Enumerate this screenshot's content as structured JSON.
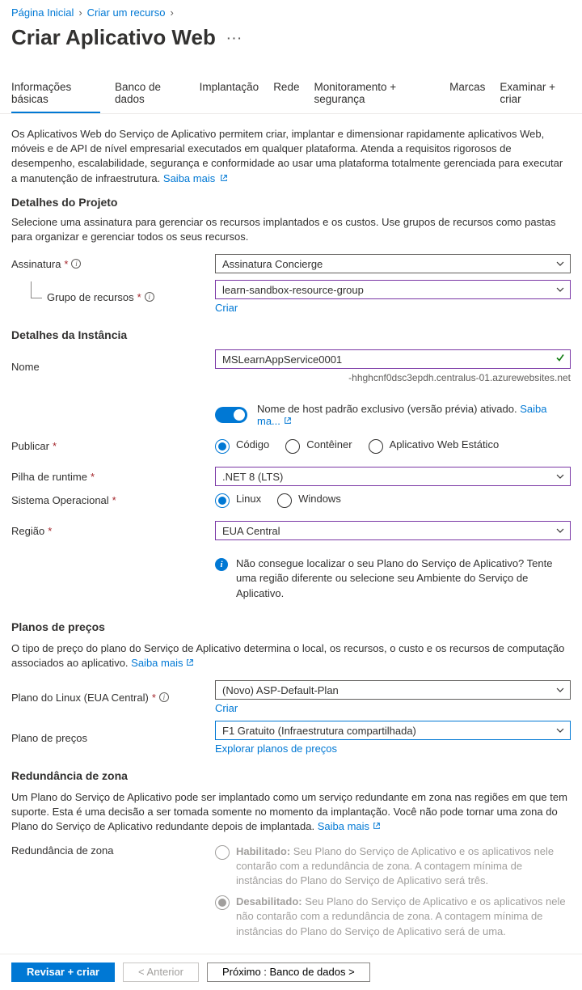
{
  "breadcrumb": {
    "home": "Página Inicial",
    "create": "Criar um recurso"
  },
  "title": "Criar Aplicativo Web",
  "tabs": [
    "Informações básicas",
    "Banco de dados",
    "Implantação",
    "Rede",
    "Monitoramento + segurança",
    "Marcas",
    "Examinar + criar"
  ],
  "intro": "Os Aplicativos Web do Serviço de Aplicativo permitem criar, implantar e dimensionar rapidamente aplicativos Web, móveis e de API de nível empresarial executados em qualquer plataforma. Atenda a requisitos rigorosos de desempenho, escalabilidade, segurança e conformidade ao usar uma plataforma totalmente gerenciada para executar a manutenção de infraestrutura.",
  "learn_more": "Saiba mais",
  "project": {
    "heading": "Detalhes do Projeto",
    "desc": "Selecione uma assinatura para gerenciar os recursos implantados e os custos. Use grupos de recursos como pastas para organizar e gerenciar todos os seus recursos.",
    "subscription_label": "Assinatura",
    "subscription_value": "Assinatura Concierge",
    "rg_label": "Grupo de recursos",
    "rg_value": "learn-sandbox-resource-group",
    "rg_create": "Criar"
  },
  "instance": {
    "heading": "Detalhes da Instância",
    "name_label": "Nome",
    "name_value": "MSLearnAppService0001",
    "hostname": "-hhghcnf0dsc3epdh.centralus-01.azurewebsites.net",
    "toggle_text": "Nome de host padrão exclusivo (versão prévia) ativado.",
    "toggle_link": "Saiba ma...",
    "publish_label": "Publicar",
    "publish_options": [
      "Código",
      "Contêiner",
      "Aplicativo Web Estático"
    ],
    "runtime_label": "Pilha de runtime",
    "runtime_value": ".NET 8 (LTS)",
    "os_label": "Sistema Operacional",
    "os_options": [
      "Linux",
      "Windows"
    ],
    "region_label": "Região",
    "region_value": "EUA Central",
    "region_info": "Não consegue localizar o seu Plano do Serviço de Aplicativo? Tente uma região diferente ou selecione seu Ambiente do Serviço de Aplicativo."
  },
  "pricing": {
    "heading": "Planos de preços",
    "desc": "O tipo de preço do plano do Serviço de Aplicativo determina o local, os recursos, o custo e os recursos de computação associados ao aplicativo.",
    "plan_label": "Plano do Linux (EUA Central)",
    "plan_value": "(Novo) ASP-Default-Plan",
    "plan_create": "Criar",
    "tier_label": "Plano de preços",
    "tier_value": "F1 Gratuito (Infraestrutura compartilhada)",
    "tier_link": "Explorar planos de preços"
  },
  "zone": {
    "heading": "Redundância de zona",
    "desc": "Um Plano do Serviço de Aplicativo pode ser implantado como um serviço redundante em zona nas regiões em que tem suporte. Esta é uma decisão a ser tomada somente no momento da implantação. Você não pode tornar uma zona do Plano do Serviço de Aplicativo redundante depois de implantada.",
    "label": "Redundância de zona",
    "enabled_title": "Habilitado:",
    "enabled_desc": "Seu Plano do Serviço de Aplicativo e os aplicativos nele contarão com a redundância de zona. A contagem mínima de instâncias do Plano do Serviço de Aplicativo será três.",
    "disabled_title": "Desabilitado:",
    "disabled_desc": "Seu Plano do Serviço de Aplicativo e os aplicativos nele não contarão com a redundância de zona. A contagem mínima de instâncias do Plano do Serviço de Aplicativo será de uma."
  },
  "footer": {
    "review": "Revisar + criar",
    "prev": "< Anterior",
    "next": "Próximo : Banco de dados >"
  }
}
